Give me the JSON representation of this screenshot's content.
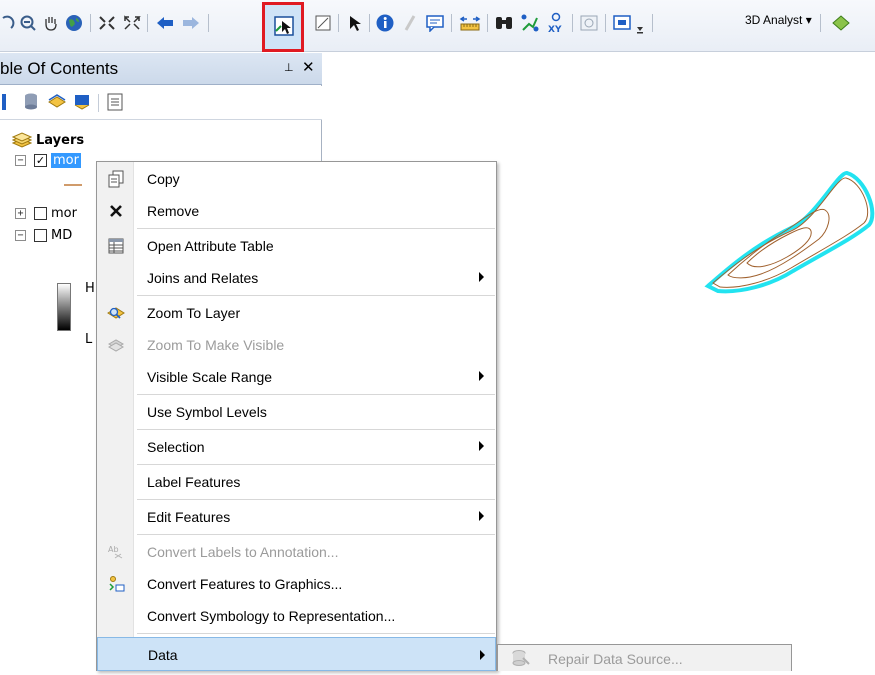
{
  "toolbar": {
    "icons": [
      "zoom-icon",
      "zoom-out-icon",
      "pan-hand-icon",
      "globe-icon",
      "fixed-zoom-in-icon",
      "fixed-zoom-out-icon",
      "back-arrow-icon",
      "forward-arrow-icon",
      "select-features-icon",
      "clear-selection-icon",
      "select-elements-icon",
      "identify-icon",
      "hyperlink-icon",
      "html-popup-icon",
      "measure-icon",
      "find-icon",
      "find-route-icon",
      "go-to-xy-icon",
      "time-slider-icon",
      "create-viewer-icon"
    ],
    "highlighted_tool": "select-features-icon",
    "extension_label": "3D Analyst",
    "highlight_color": "#e01a22"
  },
  "toc": {
    "title": "ble Of Contents",
    "pin_glyph": "⊥",
    "close_glyph": "✕",
    "layers_label": "Layers",
    "layer_rows": [
      {
        "label": "mor",
        "checked": true,
        "expanded": true,
        "selected": true
      },
      {
        "label": "mor",
        "checked": false,
        "expanded": false
      },
      {
        "label": "MD",
        "checked": false,
        "expanded": true
      }
    ],
    "legend_high": "H",
    "legend_low": "L"
  },
  "context_menu": {
    "items": [
      {
        "label": "Copy",
        "icon": "copy-icon",
        "enabled": true
      },
      {
        "label": "Remove",
        "icon": "remove-icon",
        "enabled": true
      },
      {
        "label": "Open Attribute Table",
        "icon": "attribute-table-icon",
        "enabled": true
      },
      {
        "label": "Joins and Relates",
        "enabled": true,
        "submenu": true
      },
      {
        "label": "Zoom To Layer",
        "icon": "zoom-to-layer-icon",
        "enabled": true
      },
      {
        "label": "Zoom To Make Visible",
        "icon": "zoom-to-make-visible-icon",
        "enabled": false
      },
      {
        "label": "Visible Scale Range",
        "enabled": true,
        "submenu": true
      },
      {
        "label": "Use Symbol Levels",
        "enabled": true
      },
      {
        "label": "Selection",
        "enabled": true,
        "submenu": true
      },
      {
        "label": "Label Features",
        "enabled": true
      },
      {
        "label": "Edit Features",
        "enabled": true,
        "submenu": true
      },
      {
        "label": "Convert Labels to Annotation...",
        "icon": "convert-labels-icon",
        "enabled": false
      },
      {
        "label": "Convert Features to Graphics...",
        "icon": "convert-features-icon",
        "enabled": true
      },
      {
        "label": "Convert Symbology to Representation...",
        "enabled": true
      },
      {
        "label": "Data",
        "enabled": true,
        "submenu": true,
        "hovered": true
      }
    ],
    "hover_color": "#cde3f7"
  },
  "submenu": {
    "items": [
      {
        "label": "Repair Data Source...",
        "icon": "repair-data-source-icon",
        "enabled": false
      }
    ]
  },
  "map": {
    "contour_color": "#a0612e",
    "selection_color": "#22e3f0"
  }
}
